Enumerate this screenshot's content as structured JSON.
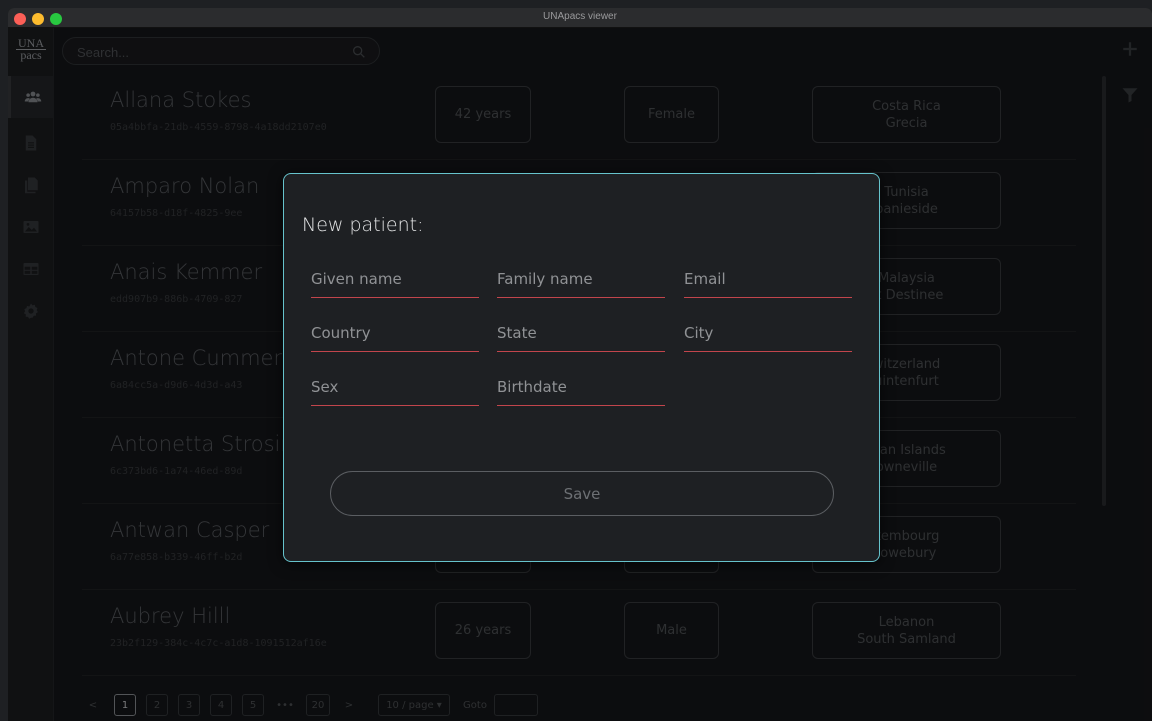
{
  "window": {
    "title": "UNApacs viewer"
  },
  "logo": {
    "line1": "UNA",
    "line2": "pacs"
  },
  "sidebar": {
    "items": [
      {
        "icon": "users-icon",
        "active": true
      },
      {
        "icon": "document-icon",
        "active": false
      },
      {
        "icon": "copy-icon",
        "active": false
      },
      {
        "icon": "image-icon",
        "active": false
      },
      {
        "icon": "table-icon",
        "active": false
      },
      {
        "icon": "gear-icon",
        "active": false
      }
    ]
  },
  "search": {
    "placeholder": "Search..."
  },
  "toolbar": {
    "add_icon": "plus-icon",
    "filter_icon": "filter-icon"
  },
  "patients": [
    {
      "name": "Allana Stokes",
      "id": "05a4bbfa-21db-4559-8798-4a18dd2107e0",
      "age": "42 years",
      "sex": "Female",
      "country": "Costa Rica",
      "city": "Grecia"
    },
    {
      "name": "Amparo Nolan",
      "id": "64157b58-d18f-4825-9ee",
      "age": "",
      "sex": "",
      "country": "Tunisia",
      "city": "panieside"
    },
    {
      "name": "Anais Kemmer",
      "id": "edd907b9-886b-4709-827",
      "age": "",
      "sex": "",
      "country": "Malaysia",
      "city": "st Destinee"
    },
    {
      "name": "Antone Cummerat",
      "id": "6a84cc5a-d9d6-4d3d-a43",
      "age": "",
      "sex": "",
      "country": "witzerland",
      "city": "uintenfurt"
    },
    {
      "name": "Antonetta Strosin",
      "id": "6c373bd6-1a74-46ed-89d",
      "age": "",
      "sex": "",
      "country": "man Islands",
      "city": "owneville"
    },
    {
      "name": "Antwan Casper",
      "id": "6a77e858-b339-46ff-b2d",
      "age": "",
      "sex": "",
      "country": "xembourg",
      "city": "lowebury"
    },
    {
      "name": "Aubrey Hilll",
      "id": "23b2f129-384c-4c7c-a1d8-1091512af16e",
      "age": "26 years",
      "sex": "Male",
      "country": "Lebanon",
      "city": "South Samland"
    }
  ],
  "pagination": {
    "prev": "<",
    "pages": [
      "1",
      "2",
      "3",
      "4",
      "5"
    ],
    "ellipsis": "•••",
    "last": "20",
    "next": ">",
    "per_page": "10 / page ▾",
    "goto": "Goto"
  },
  "modal": {
    "title": "New patient:",
    "fields": {
      "given_name": "Given name",
      "family_name": "Family name",
      "email": "Email",
      "country": "Country",
      "state": "State",
      "city": "City",
      "sex": "Sex",
      "birthdate": "Birthdate"
    },
    "save_label": "Save"
  },
  "colors": {
    "accent_border": "#66c3cc",
    "field_underline": "#c2454c"
  }
}
